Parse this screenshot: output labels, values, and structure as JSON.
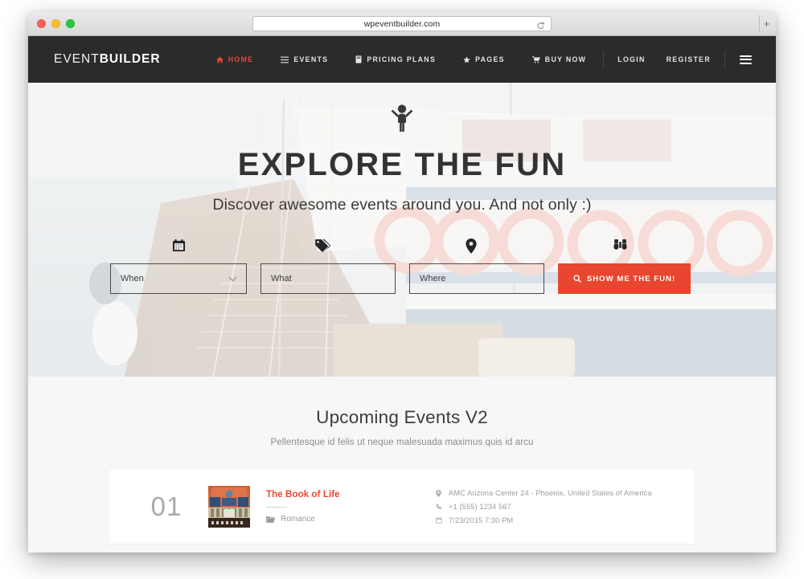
{
  "browser": {
    "url": "wpeventbuilder.com",
    "reload_icon": "reload-icon",
    "new_tab_label": "+",
    "traffic_lights": [
      "close-red",
      "minimize-yellow",
      "zoom-green"
    ]
  },
  "site": {
    "brand": {
      "part1": "EVENT",
      "part2": "BUILDER"
    },
    "nav": [
      {
        "label": "HOME",
        "icon": "home-icon",
        "active": true
      },
      {
        "label": "EVENTS",
        "icon": "list-icon",
        "active": false
      },
      {
        "label": "PRICING PLANS",
        "icon": "book-icon",
        "active": false
      },
      {
        "label": "PAGES",
        "icon": "star-icon",
        "active": false
      },
      {
        "label": "BUY NOW",
        "icon": "cart-icon",
        "active": false
      },
      {
        "label": "LOGIN",
        "icon": "",
        "active": false
      },
      {
        "label": "REGISTER",
        "icon": "",
        "active": false
      }
    ],
    "menu_toggle": "hamburger-icon"
  },
  "hero": {
    "mascot_icon": "child-icon",
    "title": "EXPLORE THE FUN",
    "subtitle": "Discover awesome events around you. And not only :)",
    "icons": [
      {
        "name": "calendar-icon"
      },
      {
        "name": "tag-icon"
      },
      {
        "name": "map-marker-icon"
      },
      {
        "name": "binoculars-icon"
      }
    ],
    "fields": [
      {
        "name": "when",
        "placeholder": "When",
        "value": "",
        "has_chevron": true
      },
      {
        "name": "what",
        "placeholder": "What",
        "value": "",
        "has_chevron": false
      },
      {
        "name": "where",
        "placeholder": "Where",
        "value": "",
        "has_chevron": false
      }
    ],
    "submit": {
      "label": "SHOW ME THE FUN!",
      "icon": "search-icon",
      "color": "#e8462f"
    }
  },
  "events_section": {
    "title": "Upcoming Events V2",
    "subtitle": "Pellentesque id felis ut neque malesuada maximus quis id arcu",
    "items": [
      {
        "number": "01",
        "thumb_alt": "the-book-of-life-poster",
        "name": "The Book of Life",
        "category": "Romance",
        "category_icon": "folder-icon",
        "location": "AMC Arizona Center 24 - Phoenix, United States of America",
        "location_icon": "map-marker-icon",
        "phone": "+1 (555) 1234 567",
        "phone_icon": "phone-icon",
        "datetime": "7/23/2015 7:30 PM",
        "date_icon": "calendar-icon"
      }
    ]
  },
  "colors": {
    "accent": "#e8462f",
    "navbar": "#2b2b2b",
    "section_bg": "#f7f7f7",
    "card_bg": "#ffffff"
  }
}
